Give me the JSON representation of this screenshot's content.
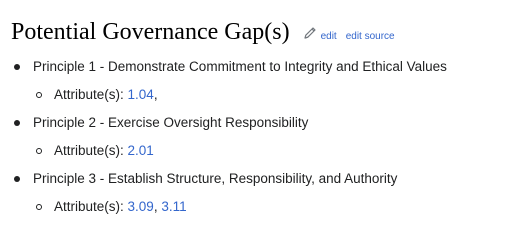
{
  "heading": {
    "title": "Potential Governance Gap(s)",
    "edit_label": "edit",
    "edit_source_label": "edit source",
    "icon": "pencil-icon"
  },
  "colors": {
    "link": "#3366cc",
    "text": "#202122"
  },
  "principles": [
    {
      "label": "Principle 1 - Demonstrate Commitment to Integrity and Ethical Values",
      "attr_prefix": "Attribute(s): ",
      "attributes": [
        "1.04"
      ],
      "trailing": ","
    },
    {
      "label": "Principle 2 - Exercise Oversight Responsibility",
      "attr_prefix": "Attribute(s): ",
      "attributes": [
        "2.01"
      ],
      "trailing": ""
    },
    {
      "label": "Principle 3 - Establish Structure, Responsibility, and Authority",
      "attr_prefix": "Attribute(s): ",
      "attributes": [
        "3.09",
        "3.11"
      ],
      "trailing": ""
    }
  ]
}
